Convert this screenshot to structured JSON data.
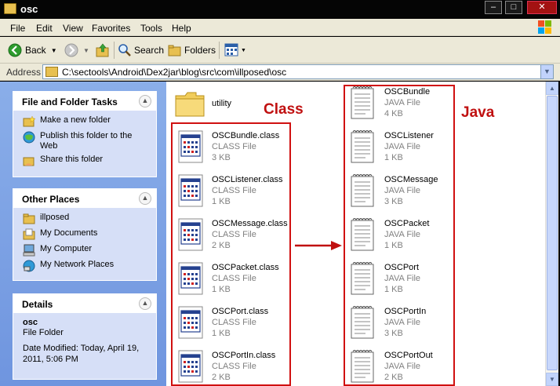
{
  "window": {
    "title": "osc"
  },
  "menu": [
    "File",
    "Edit",
    "View",
    "Favorites",
    "Tools",
    "Help"
  ],
  "toolbar": {
    "back": "Back",
    "search": "Search",
    "folders": "Folders"
  },
  "address": {
    "label": "Address",
    "path": "C:\\sectools\\Android\\Dex2jar\\blog\\src\\com\\illposed\\osc"
  },
  "tasks_panel": {
    "title": "File and Folder Tasks",
    "items": [
      "Make a new folder",
      "Publish this folder to the Web",
      "Share this folder"
    ]
  },
  "places_panel": {
    "title": "Other Places",
    "items": [
      "illposed",
      "My Documents",
      "My Computer",
      "My Network Places"
    ]
  },
  "details_panel": {
    "title": "Details",
    "name": "osc",
    "type": "File Folder",
    "modified": "Date Modified: Today, April 19, 2011, 5:06 PM"
  },
  "folder": {
    "name": "utility"
  },
  "class_files": [
    {
      "name": "OSCBundle.class",
      "type": "CLASS File",
      "size": "3 KB"
    },
    {
      "name": "OSCListener.class",
      "type": "CLASS File",
      "size": "1 KB"
    },
    {
      "name": "OSCMessage.class",
      "type": "CLASS File",
      "size": "2 KB"
    },
    {
      "name": "OSCPacket.class",
      "type": "CLASS File",
      "size": "1 KB"
    },
    {
      "name": "OSCPort.class",
      "type": "CLASS File",
      "size": "1 KB"
    },
    {
      "name": "OSCPortIn.class",
      "type": "CLASS File",
      "size": "2 KB"
    }
  ],
  "java_files": [
    {
      "name": "OSCBundle",
      "type": "JAVA File",
      "size": "4 KB"
    },
    {
      "name": "OSCListener",
      "type": "JAVA File",
      "size": "1 KB"
    },
    {
      "name": "OSCMessage",
      "type": "JAVA File",
      "size": "3 KB"
    },
    {
      "name": "OSCPacket",
      "type": "JAVA File",
      "size": "1 KB"
    },
    {
      "name": "OSCPort",
      "type": "JAVA File",
      "size": "1 KB"
    },
    {
      "name": "OSCPortIn",
      "type": "JAVA File",
      "size": "3 KB"
    },
    {
      "name": "OSCPortOut",
      "type": "JAVA File",
      "size": "2 KB"
    }
  ],
  "annotations": {
    "class_label": "Class",
    "java_label": "Java",
    "color": "#c01010"
  }
}
